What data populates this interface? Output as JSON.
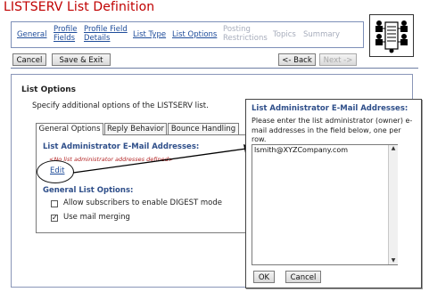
{
  "title": "LISTSERV List Definition",
  "nav": {
    "items": [
      {
        "label": "General"
      },
      {
        "label_line1": "Profile",
        "label_line2": "Fields"
      },
      {
        "label_line1": "Profile Field",
        "label_line2": "Details"
      },
      {
        "label": "List Type"
      },
      {
        "label": "List Options"
      },
      {
        "label_line1": "Posting",
        "label_line2": "Restrictions"
      },
      {
        "label": "Topics"
      },
      {
        "label": "Summary"
      }
    ]
  },
  "buttons": {
    "cancel": "Cancel",
    "save_exit": "Save & Exit",
    "back": "<- Back",
    "next": "Next ->"
  },
  "panel": {
    "heading": "List Options",
    "description": "Specify additional options of the LISTSERV list.",
    "tabs": [
      "General Options",
      "Reply Behavior",
      "Bounce Handling"
    ],
    "admin_heading": "List Administrator E-Mail Addresses:",
    "no_admin_text": "<No list administrator addresses defined>",
    "edit_label": "Edit",
    "general_heading": "General List Options:",
    "options": [
      {
        "label": "Allow subscribers to enable DIGEST mode",
        "checked": false
      },
      {
        "label": "Use mail merging",
        "checked": true
      }
    ]
  },
  "popup": {
    "heading": "List Administrator E-Mail Addresses:",
    "description": "Please enter the list administrator (owner) e-mail addresses in the field below, one per row.",
    "textarea_value": "lsmith@XYZCompany.com",
    "ok_label": "OK",
    "cancel_label": "Cancel"
  },
  "colors": {
    "title": "#c00000",
    "link": "#1e4c9a",
    "section_heading": "#2f4f8a",
    "border": "#7d8fb8"
  },
  "icons": [
    "list-definition-icon",
    "arrow-icon",
    "scroll-up-icon",
    "scroll-down-icon"
  ]
}
